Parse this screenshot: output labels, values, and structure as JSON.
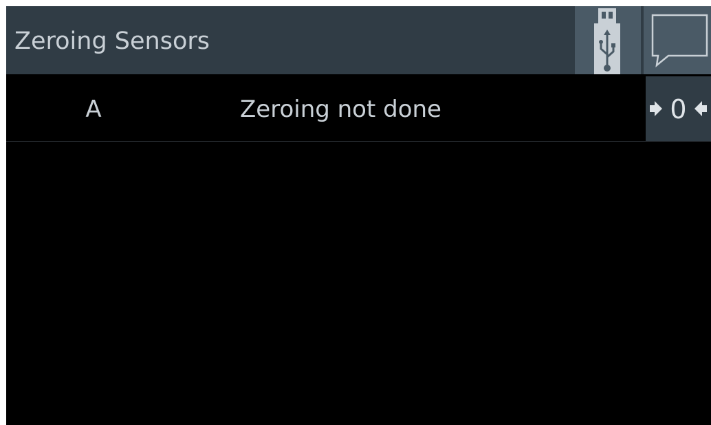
{
  "header": {
    "title": "Zeroing Sensors",
    "usb_icon": "usb-drive-icon",
    "message_icon": "speech-bubble-icon"
  },
  "sensors": [
    {
      "name": "A",
      "status": "Zeroing not done",
      "zero_button": {
        "icon": "zero-arrows-icon",
        "digit": "0"
      }
    }
  ],
  "colors": {
    "header_bg": "#303c45",
    "button_bg": "#4a5a66",
    "text": "#c9d0d6",
    "background": "#000000"
  }
}
